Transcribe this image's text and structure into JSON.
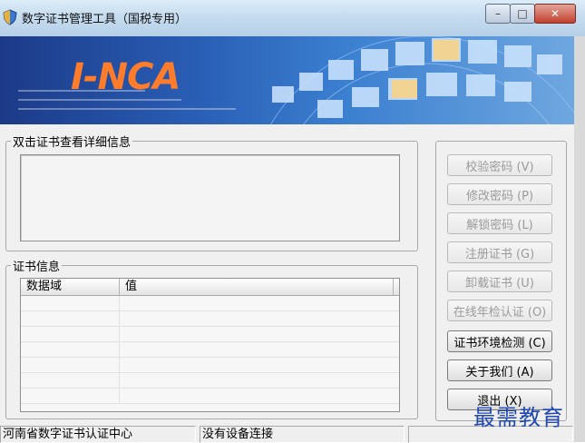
{
  "window": {
    "title": "数字证书管理工具（国税专用）"
  },
  "title_buttons": {
    "minimize": "–",
    "maximize": "□",
    "close": "✕"
  },
  "banner": {
    "logo": "I-NCA"
  },
  "groups": {
    "detail_label": "双击证书查看详细信息",
    "cert_info_label": "证书信息"
  },
  "table": {
    "columns": [
      "数据域",
      "值"
    ],
    "rows": []
  },
  "buttons": [
    {
      "label": "校验密码 (V)",
      "enabled": false
    },
    {
      "label": "修改密码 (P)",
      "enabled": false
    },
    {
      "label": "解锁密码 (L)",
      "enabled": false
    },
    {
      "label": "注册证书 (G)",
      "enabled": false
    },
    {
      "label": "卸载证书 (U)",
      "enabled": false
    },
    {
      "label": "在线年检认证 (O)",
      "enabled": false
    },
    {
      "label": "证书环境检测 (C)",
      "enabled": true
    },
    {
      "label": "关于我们 (A)",
      "enabled": true
    },
    {
      "label": "退出 (X)",
      "enabled": true
    }
  ],
  "status": {
    "org": "河南省数字证书认证中心",
    "device": "没有设备连接",
    "extra": ""
  },
  "watermark": "最需教育"
}
